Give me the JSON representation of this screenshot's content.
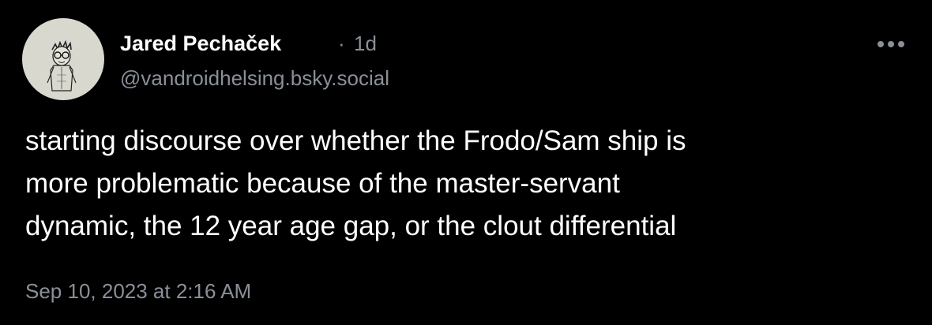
{
  "post": {
    "author": {
      "display_name": "Jared Pechaček",
      "handle": "@vandroidhelsing.bsky.social",
      "avatar": "sketch-portrait-avatar"
    },
    "meta_separator": "·",
    "relative_time": "1d",
    "body_lines": [
      "starting discourse over whether the Frodo/Sam ship is",
      "more problematic because of the master-servant",
      "dynamic, the 12 year age gap, or the clout differential"
    ],
    "timestamp": "Sep 10, 2023 at 2:16 AM",
    "more_menu_icon": "ellipsis-horizontal-icon"
  },
  "colors": {
    "background": "#000000",
    "primary_text": "#ffffff",
    "secondary_text": "#8a8f98",
    "avatar_bg": "#d9d8cf"
  }
}
